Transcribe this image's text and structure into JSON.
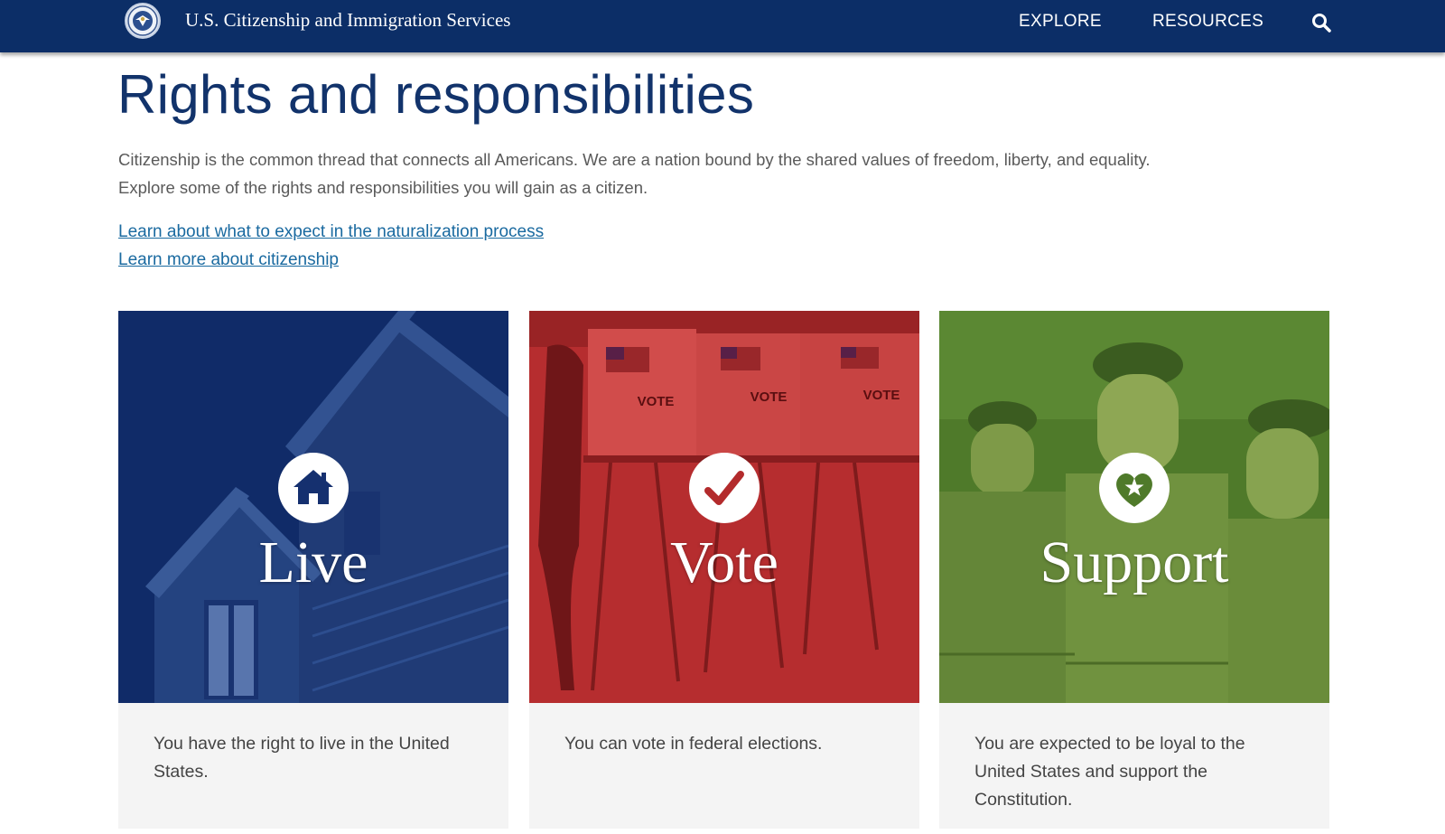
{
  "header": {
    "agency": "U.S. Citizenship and Immigration Services",
    "nav": [
      {
        "label": "EXPLORE"
      },
      {
        "label": "RESOURCES"
      }
    ],
    "search_icon": "search-icon",
    "bg_color": "#0c2e67"
  },
  "page": {
    "title": "Rights and responsibilities",
    "intro_line1": "Citizenship is the common thread that connects all Americans. We are a nation bound by the shared values of freedom, liberty, and equality.",
    "intro_line2": "Explore some of the rights and responsibilities you will gain as a citizen.",
    "links": [
      {
        "label": "Learn about what to expect in the naturalization process"
      },
      {
        "label": "Learn more about citizenship"
      }
    ]
  },
  "cards": [
    {
      "label": "Live",
      "icon": "house-icon",
      "tint": "#15306f",
      "text": "You have the right to live in the United States."
    },
    {
      "label": "Vote",
      "icon": "checkmark-icon",
      "tint": "#c3393a",
      "text": "You can vote in federal elections."
    },
    {
      "label": "Support",
      "icon": "heart-star-icon",
      "tint": "#4f7a2a",
      "text": "You are expected to be loyal to the United States and support the Constitution."
    }
  ],
  "ballot_sign": "VOTE"
}
